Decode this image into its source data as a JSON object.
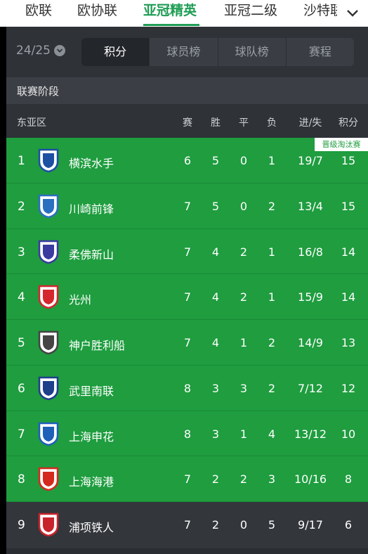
{
  "top_tabs": [
    "欧联",
    "欧协联",
    "亚冠精英",
    "亚冠二级",
    "沙特联"
  ],
  "active_top_tab": "亚冠精英",
  "season": "24/25",
  "segments": [
    "积分",
    "球员榜",
    "球队榜",
    "赛程"
  ],
  "active_segment": "积分",
  "stage_label": "联赛阶段",
  "group_name": "东亚区",
  "columns": {
    "played": "赛",
    "won": "胜",
    "drawn": "平",
    "lost": "负",
    "goals": "进/失",
    "points": "积分"
  },
  "qualification_tag": "晋级淘汰赛",
  "teams": [
    {
      "rank": "1",
      "name": "横滨水手",
      "played": "6",
      "won": "5",
      "drawn": "0",
      "lost": "1",
      "goals": "19/7",
      "points": "15",
      "badge_color": "#1d4fa3"
    },
    {
      "rank": "2",
      "name": "川崎前锋",
      "played": "7",
      "won": "5",
      "drawn": "0",
      "lost": "2",
      "goals": "13/4",
      "points": "15",
      "badge_color": "#2b6fc0"
    },
    {
      "rank": "3",
      "name": "柔佛新山",
      "played": "7",
      "won": "4",
      "drawn": "2",
      "lost": "1",
      "goals": "16/8",
      "points": "14",
      "badge_color": "#3a3aa0"
    },
    {
      "rank": "4",
      "name": "光州",
      "played": "7",
      "won": "4",
      "drawn": "2",
      "lost": "1",
      "goals": "15/9",
      "points": "14",
      "badge_color": "#d4262c"
    },
    {
      "rank": "5",
      "name": "神户胜利船",
      "played": "7",
      "won": "4",
      "drawn": "1",
      "lost": "2",
      "goals": "14/9",
      "points": "13",
      "badge_color": "#444444"
    },
    {
      "rank": "6",
      "name": "武里南联",
      "played": "8",
      "won": "3",
      "drawn": "3",
      "lost": "2",
      "goals": "7/12",
      "points": "12",
      "badge_color": "#1e3f8a"
    },
    {
      "rank": "7",
      "name": "上海申花",
      "played": "8",
      "won": "3",
      "drawn": "1",
      "lost": "4",
      "goals": "13/12",
      "points": "10",
      "badge_color": "#1e5fb8"
    },
    {
      "rank": "8",
      "name": "上海海港",
      "played": "7",
      "won": "2",
      "drawn": "2",
      "lost": "3",
      "goals": "10/16",
      "points": "8",
      "badge_color": "#d42a1e"
    },
    {
      "rank": "9",
      "name": "浦项铁人",
      "played": "7",
      "won": "2",
      "drawn": "0",
      "lost": "5",
      "goals": "9/17",
      "points": "6",
      "badge_color": "#c8232c"
    }
  ],
  "colors": {
    "accent": "#1f9d55",
    "qualified_row": "#1f9d3f",
    "background": "#2a2d31"
  }
}
